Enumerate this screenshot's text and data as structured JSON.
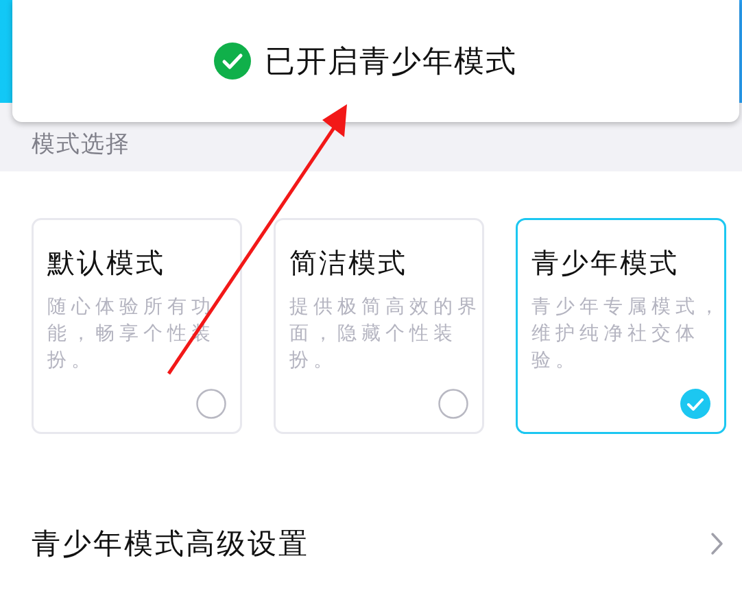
{
  "toast": {
    "text": "已开启青少年模式"
  },
  "section": {
    "title": "模式选择"
  },
  "modes": [
    {
      "title": "默认模式",
      "description_lines": [
        "随心体验所有功",
        "能，畅享个性装",
        "扮。"
      ],
      "selected": false
    },
    {
      "title": "简洁模式",
      "description_lines": [
        "提供极简高效的界",
        "面，隐藏个性装",
        "扮。"
      ],
      "selected": false
    },
    {
      "title": "青少年模式",
      "description_lines": [
        "青少年专属模式，",
        "维护纯净社交体",
        "验。"
      ],
      "selected": true
    }
  ],
  "settings_row": {
    "label": "青少年模式高级设置"
  }
}
